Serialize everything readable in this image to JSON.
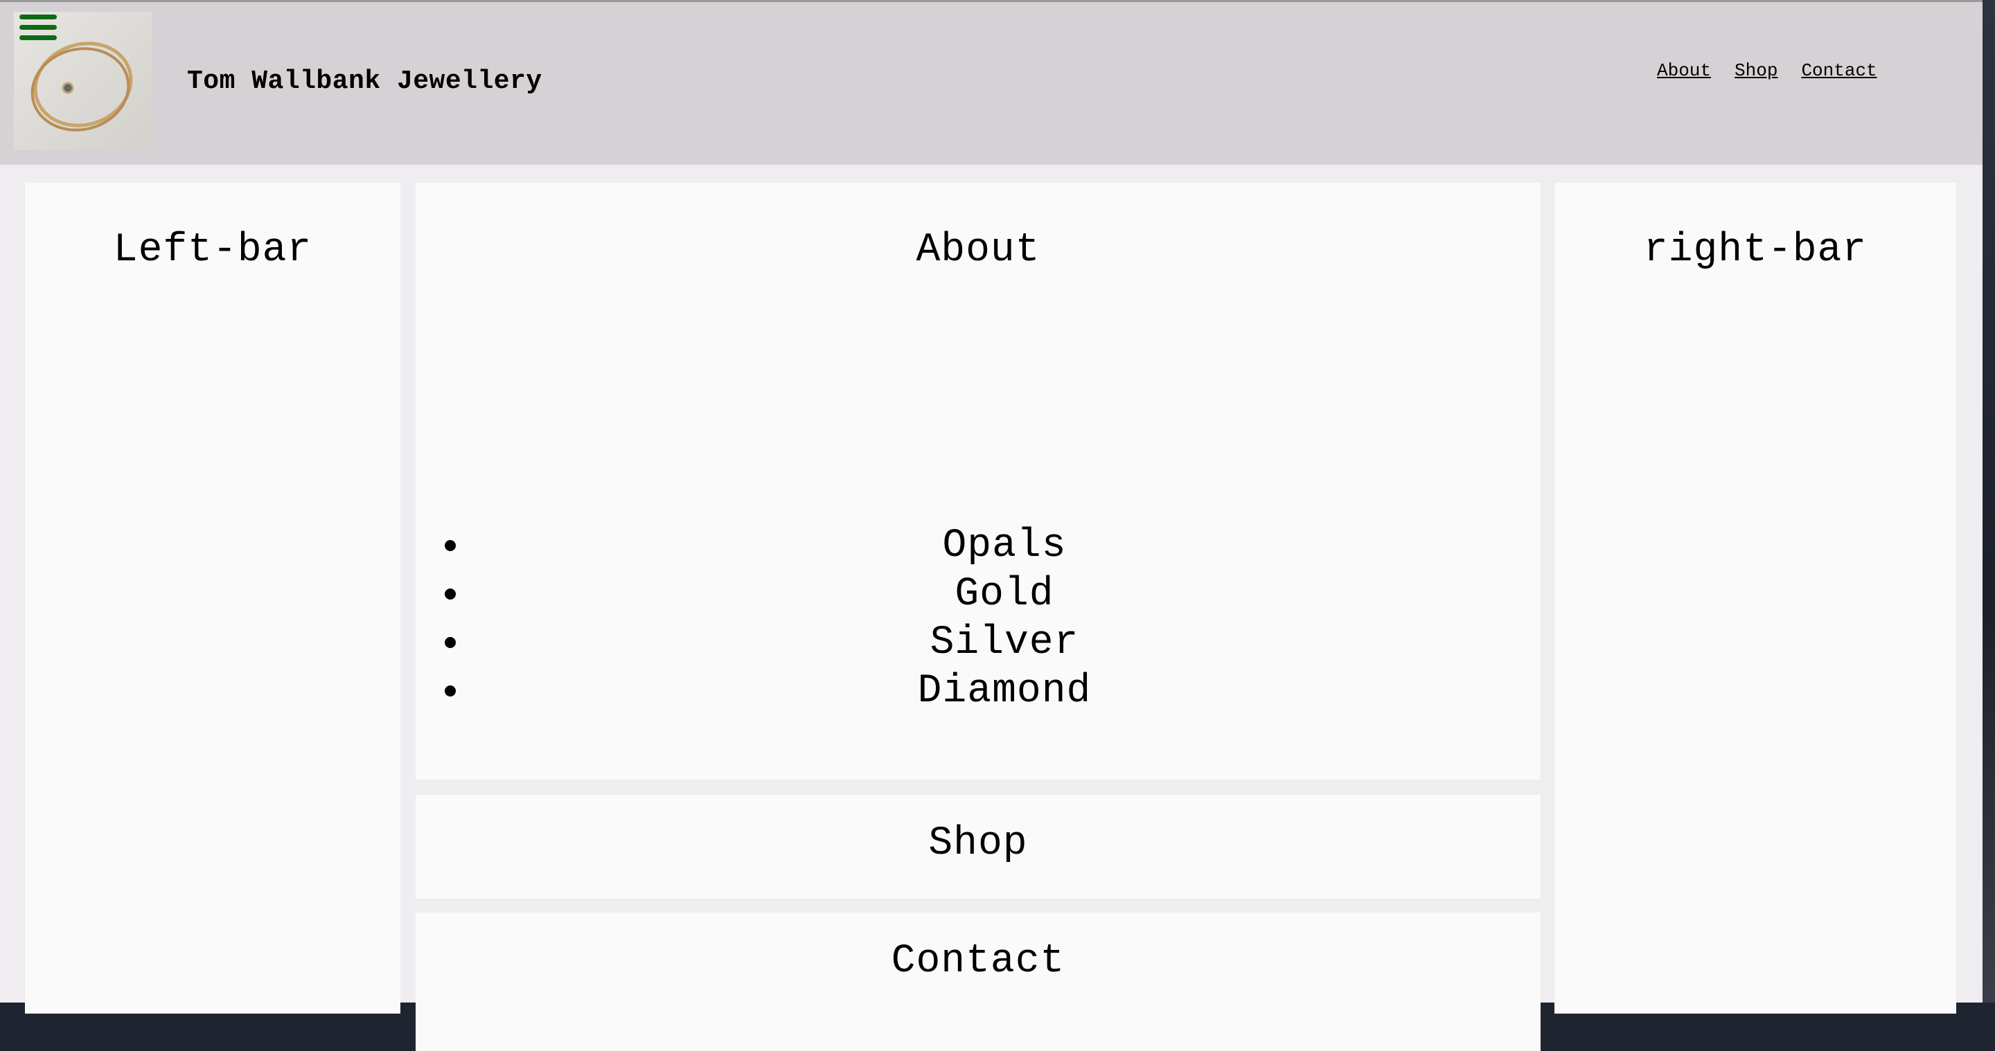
{
  "header": {
    "site_title": "Tom Wallbank Jewellery",
    "nav": {
      "about": "About",
      "shop": "Shop",
      "contact": "Contact"
    }
  },
  "left_bar": {
    "title": "Left-bar"
  },
  "right_bar": {
    "title": "right-bar"
  },
  "about": {
    "title": "About",
    "items": [
      "Opals",
      "Gold",
      "Silver",
      "Diamond"
    ]
  },
  "shop": {
    "title": "Shop"
  },
  "contact": {
    "title": "Contact"
  },
  "colors": {
    "header_bg": "#d5d1d5",
    "page_bg": "#efedf0",
    "panel_bg": "#fafafa",
    "menu_icon": "#0d6b15"
  }
}
